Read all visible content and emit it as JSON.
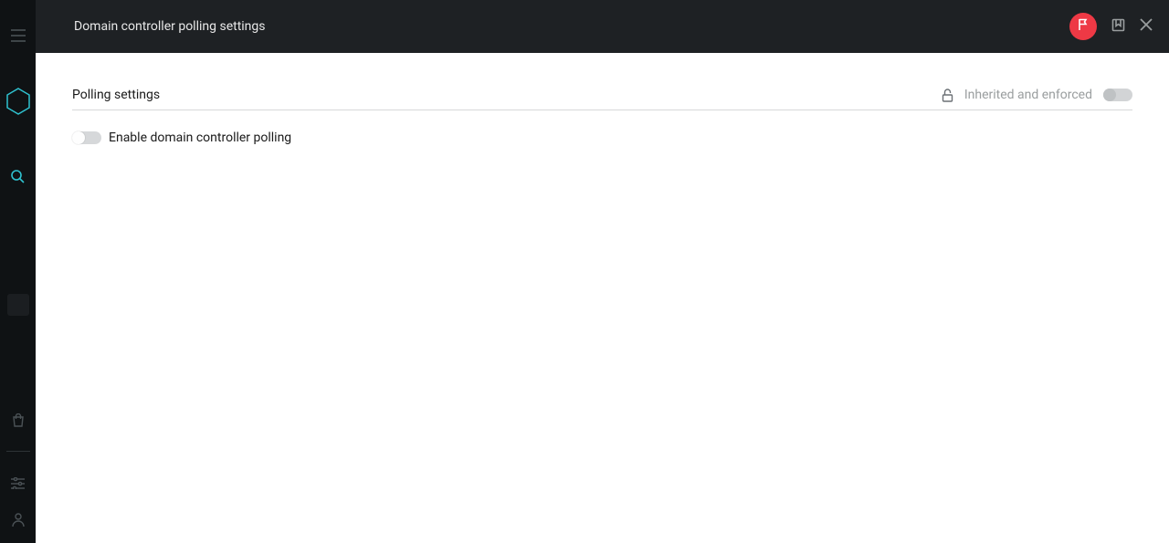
{
  "header": {
    "title": "Domain controller polling settings"
  },
  "section": {
    "title": "Polling settings",
    "inherit_label": "Inherited and enforced"
  },
  "settings": {
    "enable_polling_label": "Enable domain controller polling"
  },
  "icons": {
    "menu": "menu-icon",
    "logo": "hexagon-logo-icon",
    "search": "search-icon",
    "marketplace": "shopping-bag-icon",
    "settings": "sliders-icon",
    "account": "user-icon",
    "flag": "flag-icon",
    "bookmark": "bookmark-icon",
    "close": "close-icon",
    "lock": "lock-open-icon"
  },
  "colors": {
    "accent_red": "#ee3945",
    "accent_teal": "#2fc2d0"
  }
}
